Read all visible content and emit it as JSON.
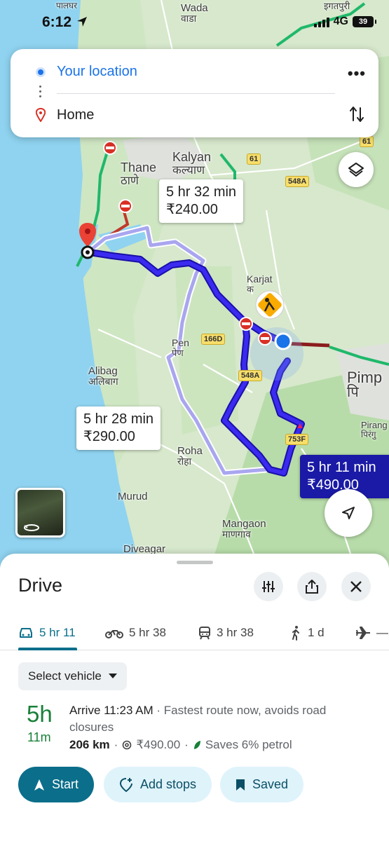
{
  "status_bar": {
    "time": "6:12",
    "network": "4G",
    "battery": "39"
  },
  "route_inputs": {
    "origin": "Your location",
    "destination": "Home"
  },
  "map": {
    "places": [
      {
        "name": "Wada",
        "local": "वाडा"
      },
      {
        "name": "पालघर",
        "local": ""
      },
      {
        "name": "इगतपुरी",
        "local": ""
      },
      {
        "name": "Thane",
        "local": "ठाणे"
      },
      {
        "name": "Kalyan",
        "local": "कल्याण"
      },
      {
        "name": "Karjat",
        "local": "क"
      },
      {
        "name": "Pen",
        "local": "पेण"
      },
      {
        "name": "Alibag",
        "local": "अलिबाग"
      },
      {
        "name": "Roha",
        "local": "रोहा"
      },
      {
        "name": "Murud",
        "local": ""
      },
      {
        "name": "Mangaon",
        "local": "माणगाव"
      },
      {
        "name": "Diveagar",
        "local": ""
      },
      {
        "name": "Pimp",
        "local": "पि"
      },
      {
        "name": "Pirang",
        "local": "पिरंगु"
      }
    ],
    "highway_shields": [
      "61",
      "61",
      "548A",
      "166D",
      "548A",
      "753F"
    ],
    "route_labels": [
      {
        "duration": "5 hr 32 min",
        "price": "₹240.00",
        "selected": false
      },
      {
        "duration": "5 hr 28 min",
        "price": "₹290.00",
        "selected": false
      },
      {
        "duration": "5 hr 11 min",
        "price": "₹490.00",
        "selected": true
      }
    ],
    "route_color": "#2d1fd6"
  },
  "sheet": {
    "title": "Drive",
    "modes": [
      {
        "icon": "car-icon",
        "label": "5 hr 11",
        "active": true
      },
      {
        "icon": "motorbike-icon",
        "label": "5 hr 38",
        "active": false
      },
      {
        "icon": "train-icon",
        "label": "3 hr 38",
        "active": false
      },
      {
        "icon": "walk-icon",
        "label": "1 d",
        "active": false
      },
      {
        "icon": "flight-icon",
        "label": "—",
        "active": false
      }
    ],
    "vehicle_select": "Select vehicle",
    "summary": {
      "hours": "5h",
      "minutes": "11m",
      "arrive": "Arrive 11:23 AM",
      "note": " · Fastest route now, avoids road closures",
      "distance": "206 km",
      "toll": "₹490.00",
      "saves": "Saves 6% petrol"
    },
    "actions": {
      "start": "Start",
      "add_stops": "Add stops",
      "saved": "Saved"
    }
  }
}
